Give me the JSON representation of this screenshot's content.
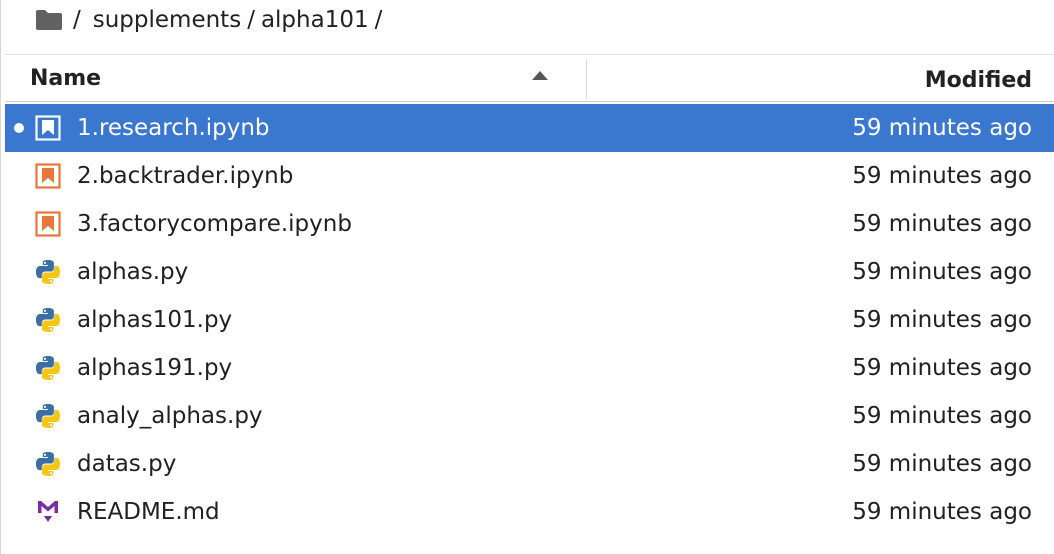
{
  "breadcrumb": {
    "icon": "folder-icon",
    "root_sep": "/",
    "segments": [
      "supplements",
      "alpha101"
    ],
    "trailing_sep": "/"
  },
  "header": {
    "name_label": "Name",
    "modified_label": "Modified",
    "sort": "ascending"
  },
  "colors": {
    "selected_bg": "#3a77cf",
    "notebook_orange": "#e8773a",
    "python_blue": "#3a6fa5",
    "python_yellow": "#f5c518",
    "markdown_purple": "#7b2d9e"
  },
  "files": [
    {
      "name": "1.research.ipynb",
      "modified": "59 minutes ago",
      "type": "notebook",
      "icon": "notebook-icon",
      "selected": true,
      "running": true
    },
    {
      "name": "2.backtrader.ipynb",
      "modified": "59 minutes ago",
      "type": "notebook",
      "icon": "notebook-icon",
      "selected": false,
      "running": false
    },
    {
      "name": "3.factorycompare.ipynb",
      "modified": "59 minutes ago",
      "type": "notebook",
      "icon": "notebook-icon",
      "selected": false,
      "running": false
    },
    {
      "name": "alphas.py",
      "modified": "59 minutes ago",
      "type": "python",
      "icon": "python-icon",
      "selected": false,
      "running": false
    },
    {
      "name": "alphas101.py",
      "modified": "59 minutes ago",
      "type": "python",
      "icon": "python-icon",
      "selected": false,
      "running": false
    },
    {
      "name": "alphas191.py",
      "modified": "59 minutes ago",
      "type": "python",
      "icon": "python-icon",
      "selected": false,
      "running": false
    },
    {
      "name": "analy_alphas.py",
      "modified": "59 minutes ago",
      "type": "python",
      "icon": "python-icon",
      "selected": false,
      "running": false
    },
    {
      "name": "datas.py",
      "modified": "59 minutes ago",
      "type": "python",
      "icon": "python-icon",
      "selected": false,
      "running": false
    },
    {
      "name": "README.md",
      "modified": "59 minutes ago",
      "type": "markdown",
      "icon": "markdown-icon",
      "selected": false,
      "running": false
    }
  ]
}
